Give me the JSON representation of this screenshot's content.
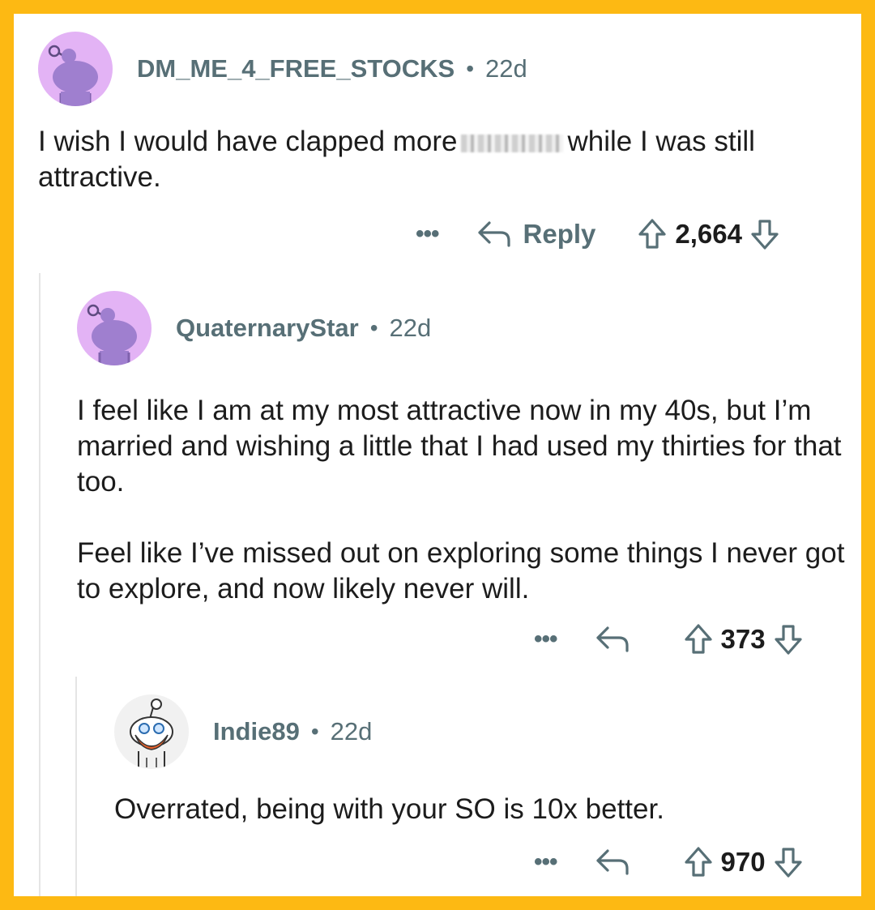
{
  "colors": {
    "frame": "#FDB913",
    "meta": "#576f76",
    "text": "#1c1c1c",
    "avatar_purple": "#E3B3F5",
    "snoo": "#A07BD0"
  },
  "comments": [
    {
      "username": "DM_ME_4_FREE_STOCKS",
      "separator": "•",
      "age": "22d",
      "text_before": "I wish I would have clapped more",
      "text_after": "while I was still attractive.",
      "more": "•••",
      "reply_label": "Reply",
      "score": "2,664"
    },
    {
      "username": "QuaternaryStar",
      "separator": "•",
      "age": "22d",
      "paragraphs": [
        "I feel like I am at my most attractive now in my 40s, but I’m married and wishing a little that I had used my thirties for that too.",
        "Feel like I’ve missed out on exploring some things I never got to explore, and now likely never will."
      ],
      "more": "•••",
      "score": "373"
    },
    {
      "username": "Indie89",
      "separator": "•",
      "age": "22d",
      "paragraphs": [
        "Overrated, being with your SO is 10x better."
      ],
      "more": "•••",
      "score": "970"
    }
  ]
}
